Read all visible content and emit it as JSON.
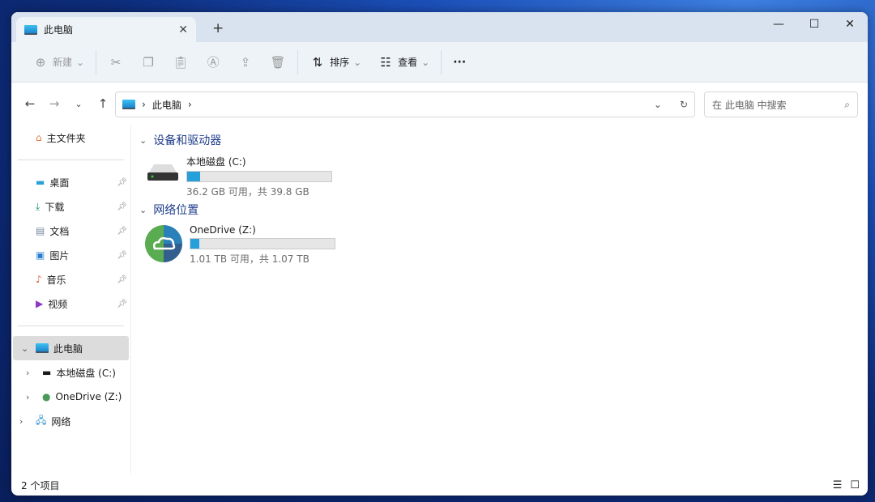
{
  "tab": {
    "title": "此电脑"
  },
  "toolbar": {
    "new": "新建",
    "sort": "排序",
    "view": "查看",
    "more": "···"
  },
  "address": {
    "path": "此电脑",
    "search_placeholder": "在 此电脑 中搜索"
  },
  "sidebar": {
    "home": "主文件夹",
    "quick": [
      {
        "label": "桌面"
      },
      {
        "label": "下载"
      },
      {
        "label": "文档"
      },
      {
        "label": "图片"
      },
      {
        "label": "音乐"
      },
      {
        "label": "视频"
      }
    ],
    "this_pc": "此电脑",
    "c_drive": "本地磁盘 (C:)",
    "onedrive": "OneDrive (Z:)",
    "network": "网络"
  },
  "main": {
    "group1": "设备和驱动器",
    "group2": "网络位置",
    "drives": [
      {
        "name": "本地磁盘 (C:)",
        "info": "36.2 GB 可用，共 39.8 GB",
        "used_pct": 9
      },
      {
        "name": "OneDrive (Z:)",
        "info": "1.01 TB 可用，共 1.07 TB",
        "used_pct": 6
      }
    ]
  },
  "status": {
    "count": "2 个项目"
  }
}
